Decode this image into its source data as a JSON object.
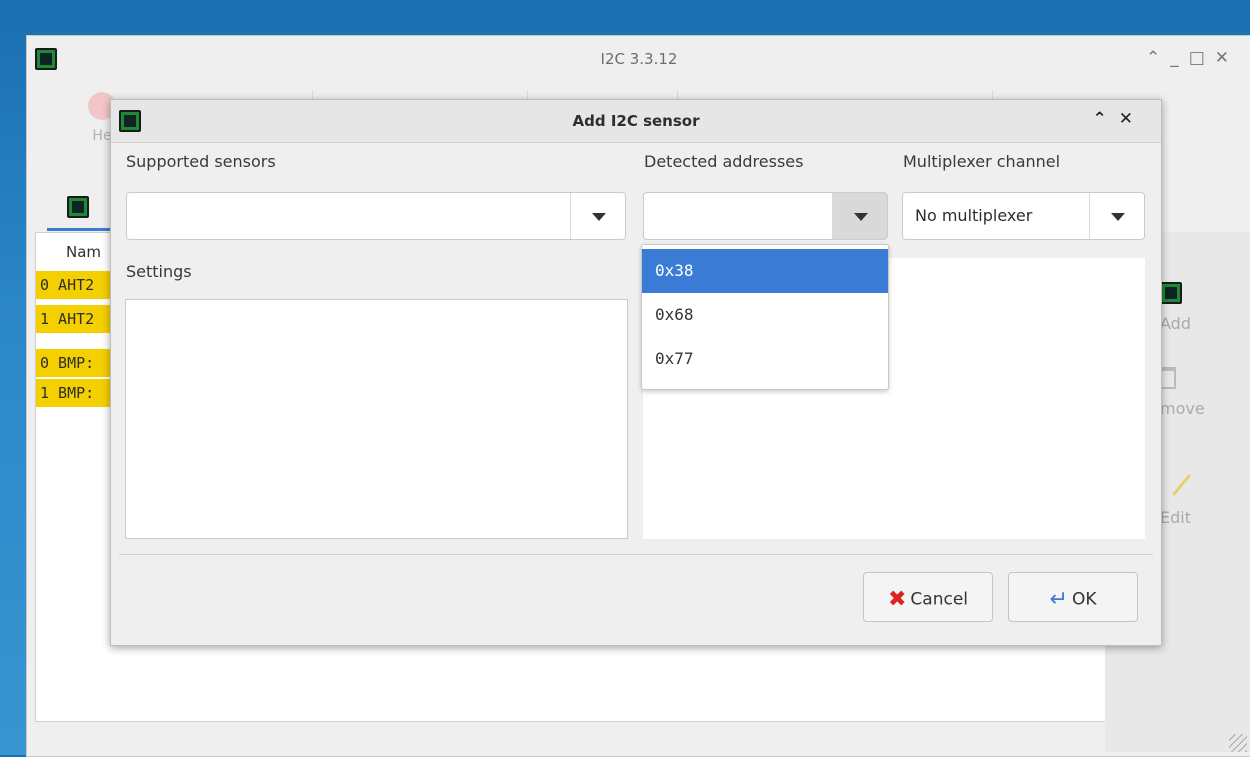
{
  "main_window": {
    "title": "I2C 3.3.12",
    "toolbar_partial_label": "He",
    "column_header": "Nam",
    "rows": [
      {
        "text": "0 AHT2"
      },
      {
        "text": "1 AHT2"
      },
      {
        "text": "0 BMP:"
      },
      {
        "text": "1 BMP:"
      }
    ],
    "side_buttons": {
      "add": "Add",
      "remove": "move",
      "edit": "Edit"
    }
  },
  "dialog": {
    "title": "Add I2C sensor",
    "supported_sensors_label": "Supported sensors",
    "supported_sensors_value": "",
    "detected_addresses_label": "Detected addresses",
    "detected_addresses_value": "",
    "multiplexer_label": "Multiplexer channel",
    "multiplexer_value": "No multiplexer",
    "settings_label": "Settings",
    "address_options": [
      "0x38",
      "0x68",
      "0x77"
    ],
    "selected_address_index": 0,
    "cancel_label": "Cancel",
    "ok_label": "OK"
  },
  "colors": {
    "selection": "#3a7bd5",
    "row_highlight": "#f5d000",
    "desktop": "#2b86c6"
  }
}
